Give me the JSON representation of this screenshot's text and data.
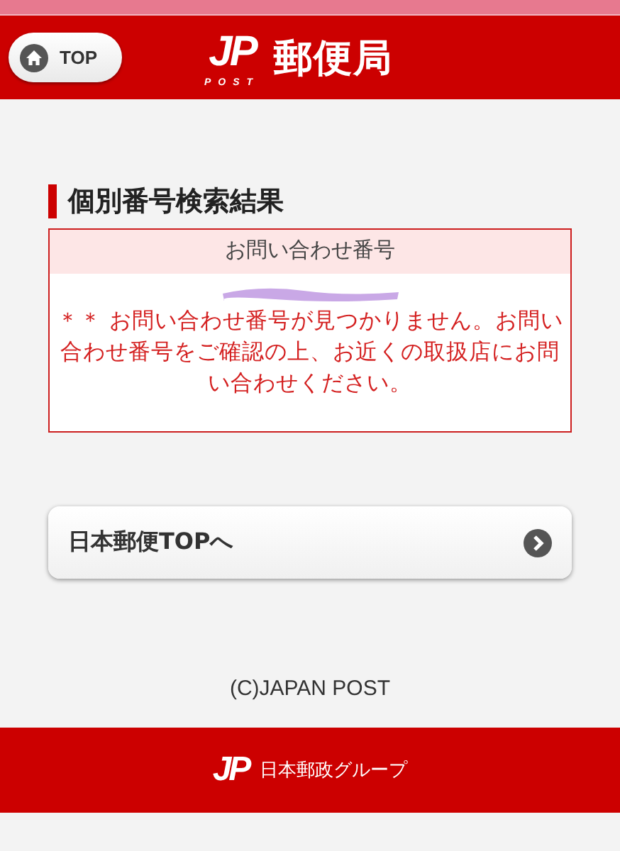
{
  "header": {
    "top_button": "TOP",
    "logo_letters": "JP",
    "logo_sub": "POST",
    "title": "郵便局"
  },
  "section": {
    "title": "個別番号検索結果"
  },
  "result": {
    "column_header": "お問い合わせ番号",
    "error_message": "＊＊ お問い合わせ番号が見つかりません。お問い合わせ番号をご確認の上、お近くの取扱店にお問い合わせください。"
  },
  "link_button": {
    "label": "日本郵便TOPへ"
  },
  "copyright": "(C)JAPAN POST",
  "footer": {
    "logo_letters": "JP",
    "group_name": "日本郵政グループ"
  }
}
